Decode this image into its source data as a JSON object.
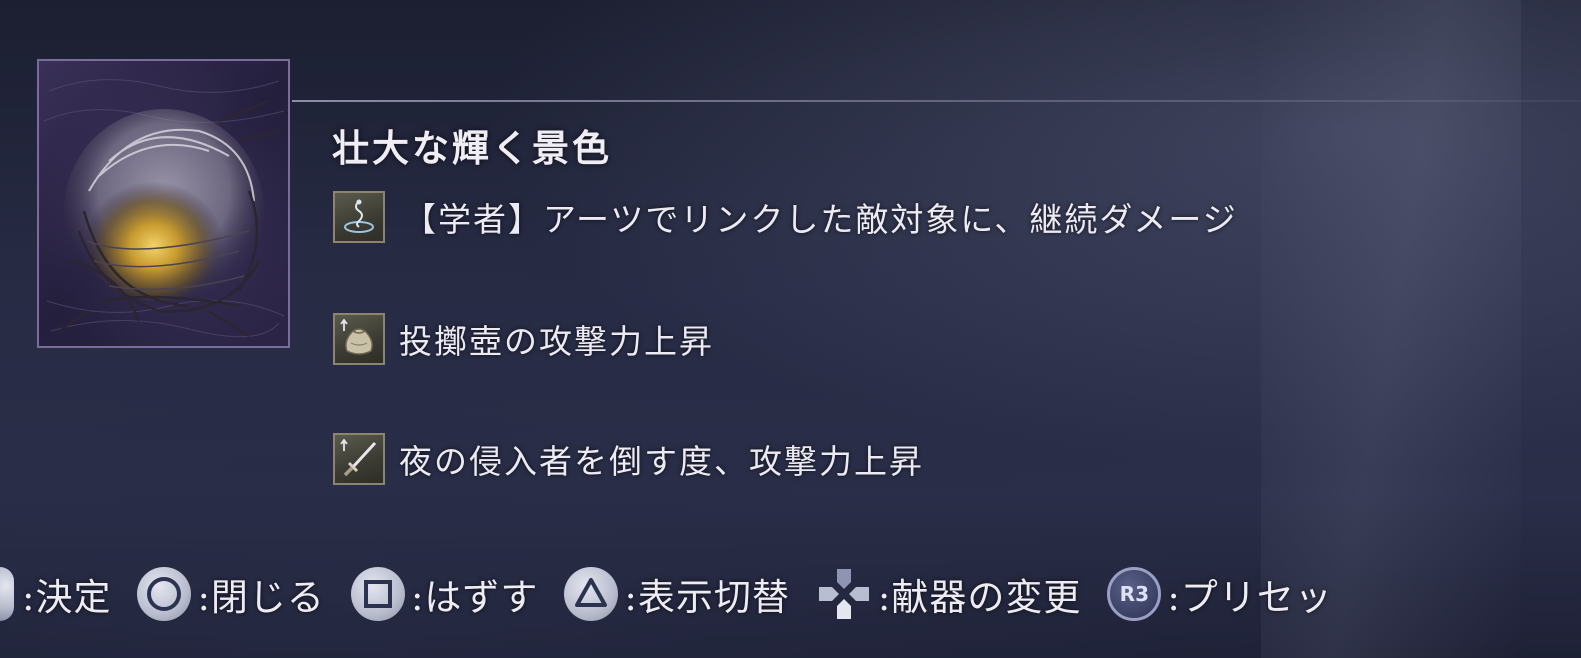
{
  "item": {
    "name": "壮大な輝く景色",
    "icon": "sunrise-nest-icon"
  },
  "effects": [
    {
      "icon": "scholar-arts-icon",
      "text": "【学者】アーツでリンクした敵対象に、継続ダメージ"
    },
    {
      "icon": "throwing-pot-attack-up-icon",
      "text": "投擲壺の攻撃力上昇"
    },
    {
      "icon": "sword-attack-up-icon",
      "text": "夜の侵入者を倒す度、攻撃力上昇"
    }
  ],
  "button_hints": [
    {
      "glyph": "cross",
      "label": ":決定"
    },
    {
      "glyph": "circle",
      "label": ":閉じる"
    },
    {
      "glyph": "square",
      "label": ":はずす"
    },
    {
      "glyph": "triangle",
      "label": ":表示切替"
    },
    {
      "glyph": "dpad",
      "label": ":献器の変更"
    },
    {
      "glyph": "R3",
      "label": ":プリセッ"
    }
  ],
  "colors": {
    "background": "#272b44",
    "frame_accent": "#7a6d9a",
    "text": "#eceaf2"
  }
}
